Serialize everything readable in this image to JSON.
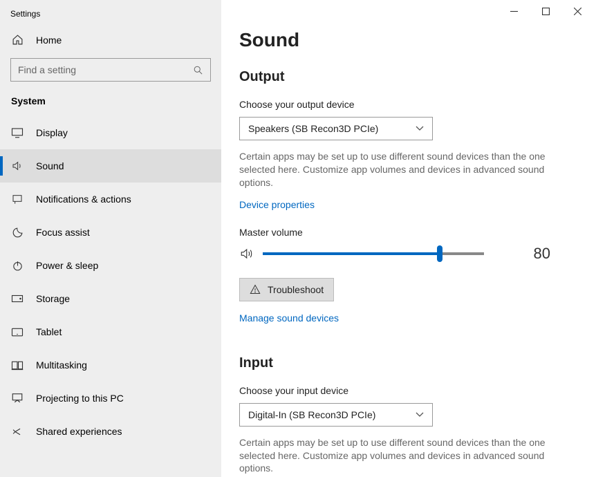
{
  "app_title": "Settings",
  "home_label": "Home",
  "search_placeholder": "Find a setting",
  "category": "System",
  "nav": [
    {
      "label": "Display"
    },
    {
      "label": "Sound"
    },
    {
      "label": "Notifications & actions"
    },
    {
      "label": "Focus assist"
    },
    {
      "label": "Power & sleep"
    },
    {
      "label": "Storage"
    },
    {
      "label": "Tablet"
    },
    {
      "label": "Multitasking"
    },
    {
      "label": "Projecting to this PC"
    },
    {
      "label": "Shared experiences"
    }
  ],
  "page_title": "Sound",
  "output": {
    "heading": "Output",
    "choose_label": "Choose your output device",
    "device": "Speakers (SB Recon3D PCIe)",
    "desc": "Certain apps may be set up to use different sound devices than the one selected here. Customize app volumes and devices in advanced sound options.",
    "props_link": "Device properties",
    "master_label": "Master volume",
    "volume": "80",
    "troubleshoot": "Troubleshoot",
    "manage_link": "Manage sound devices"
  },
  "input": {
    "heading": "Input",
    "choose_label": "Choose your input device",
    "device": "Digital-In (SB Recon3D PCIe)",
    "desc": "Certain apps may be set up to use different sound devices than the one selected here. Customize app volumes and devices in advanced sound options."
  }
}
